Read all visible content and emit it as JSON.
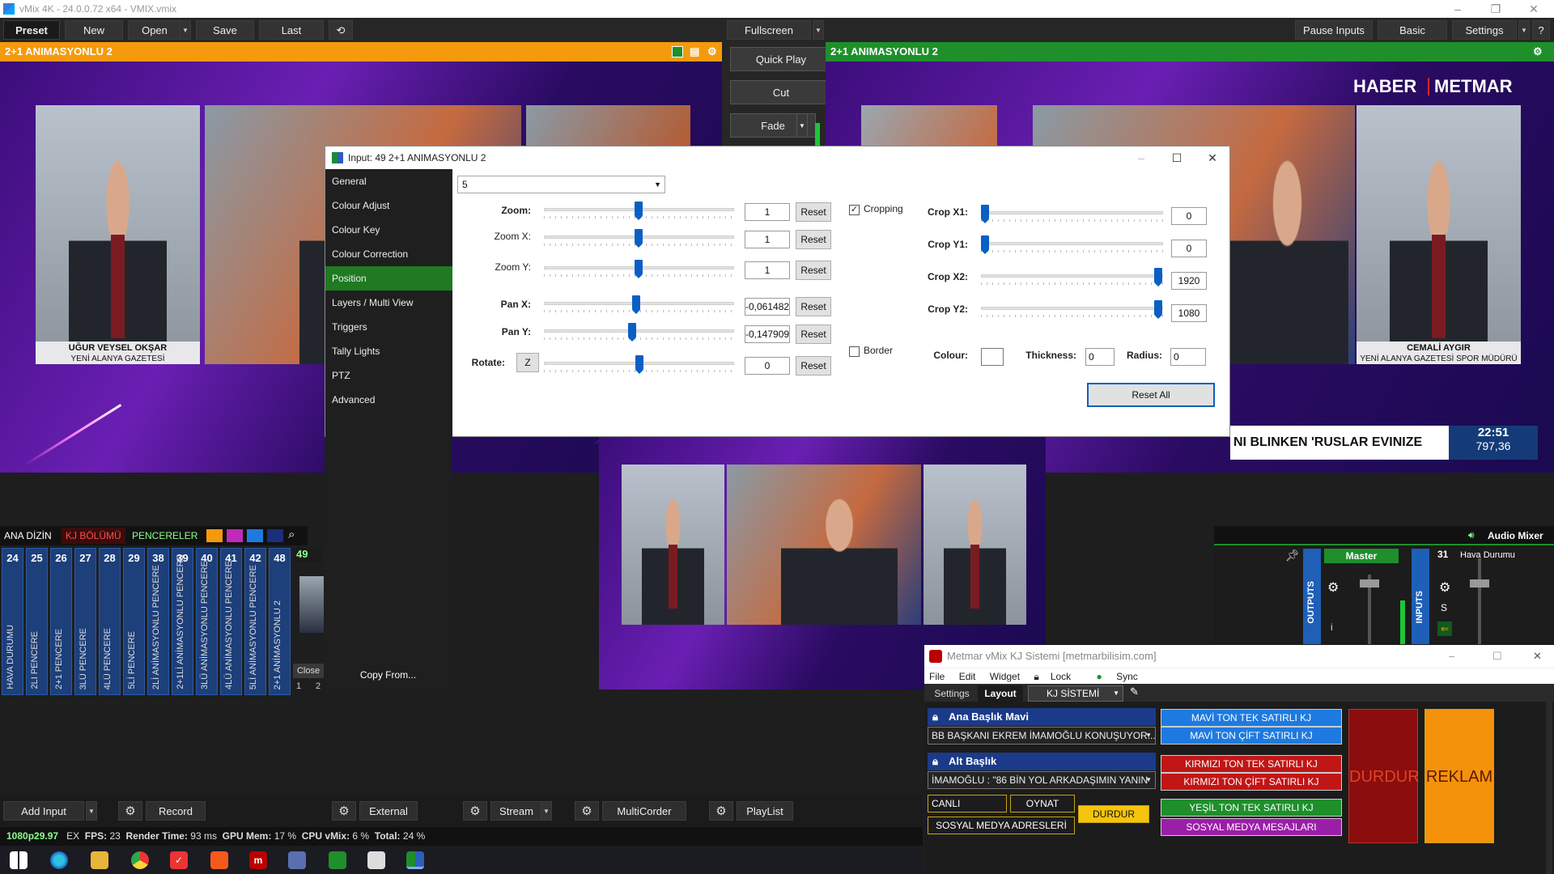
{
  "window": {
    "title": "vMix 4K - 24.0.0.72 x64 - VMIX.vmix"
  },
  "toolbar": {
    "preset": "Preset",
    "new": "New",
    "open": "Open",
    "save": "Save",
    "last": "Last",
    "fullscreen": "Fullscreen",
    "pause_inputs": "Pause Inputs",
    "basic": "Basic",
    "settings": "Settings",
    "help": "?"
  },
  "preview": {
    "title": "2+1 ANIMASYONLU 2"
  },
  "output": {
    "title": "2+1 ANIMASYONLU 2",
    "brand_left": "HABER",
    "brand_right": "METMAR",
    "ticker": "NI BLINKEN 'RUSLAR EVINIZE",
    "time": "22:51",
    "price": "797,36"
  },
  "cards": {
    "left_name": "UĞUR VEYSEL OKŞAR",
    "left_sub": "YENİ ALANYA GAZETESİ",
    "right_name": "CEMALİ AYGIR",
    "right_sub": "YENİ ALANYA GAZETESİ SPOR MÜDÜRÜ"
  },
  "transitions": {
    "quick_play": "Quick Play",
    "cut": "Cut",
    "fade": "Fade"
  },
  "dialog": {
    "title": "Input: 49 2+1 ANIMASYONLU 2",
    "sidebar": [
      "General",
      "Colour Adjust",
      "Colour Key",
      "Colour Correction",
      "Position",
      "Layers / Multi View",
      "Triggers",
      "Tally Lights",
      "PTZ",
      "Advanced"
    ],
    "active_tab": "Position",
    "copy_from": "Copy From...",
    "preset_select": "5",
    "zoom_label": "Zoom:",
    "zoom_value": "1",
    "zoomx_label": "Zoom X:",
    "zoomx_value": "1",
    "zoomy_label": "Zoom Y:",
    "zoomy_value": "1",
    "panx_label": "Pan X:",
    "panx_value": "-0,0614827",
    "pany_label": "Pan Y:",
    "pany_value": "-0,1479095",
    "rotate_label": "Rotate:",
    "rotate_z": "Z",
    "rotate_value": "0",
    "reset": "Reset",
    "cropping_label": "Cropping",
    "cropping_checked": true,
    "cropx1_label": "Crop X1:",
    "cropx1_value": "0",
    "cropy1_label": "Crop Y1:",
    "cropy1_value": "0",
    "cropx2_label": "Crop X2:",
    "cropx2_value": "1920",
    "cropy2_label": "Crop Y2:",
    "cropy2_value": "1080",
    "border_label": "Border",
    "border_checked": false,
    "colour_label": "Colour:",
    "thickness_label": "Thickness:",
    "thickness_value": "0",
    "radius_label": "Radius:",
    "radius_value": "0",
    "reset_all": "Reset All"
  },
  "input_tabs": {
    "ana": "ANA DİZİN",
    "kj": "KJ BÖLÜMÜ",
    "pencereler": "PENCERELER"
  },
  "inputs": [
    {
      "n": "24",
      "label": "HAVA DURUMU"
    },
    {
      "n": "25",
      "label": "2LI PENCERE"
    },
    {
      "n": "26",
      "label": "2+1 PENCERE"
    },
    {
      "n": "27",
      "label": "3LÜ PENCERE"
    },
    {
      "n": "28",
      "label": "4LÜ PENCERE"
    },
    {
      "n": "29",
      "label": "5Lİ PENCERE"
    },
    {
      "n": "38",
      "label": "2Lİ ANİMASYONLU PENCERE"
    },
    {
      "n": "39",
      "label": "2+1Lİ ANİMASYONLU PENCERE"
    },
    {
      "n": "40",
      "label": "3LÜ ANİMASYONLU PENCERE"
    },
    {
      "n": "41",
      "label": "4LÜ ANİMASYONLU PENCERE"
    },
    {
      "n": "42",
      "label": "5Lİ ANİMASYONLU PENCERE"
    },
    {
      "n": "48",
      "label": "2+1 ANİMASYONLU 2"
    }
  ],
  "input49": {
    "n": "49",
    "close": "Close",
    "page1": "1",
    "page2": "2"
  },
  "audio": {
    "title": "Audio Mixer",
    "master": "Master",
    "outputs": "OUTPUTS",
    "inputs": "INPUTS",
    "ch31": "31",
    "ch31_name": "Hava Durumu I",
    "s": "S",
    "i": "i"
  },
  "bottom": {
    "add_input": "Add Input",
    "record": "Record",
    "external": "External",
    "stream": "Stream",
    "multicorder": "MultiCorder",
    "playlist": "PlayList"
  },
  "status": {
    "format": "1080p29.97",
    "ex": "EX",
    "fps_label": "FPS:",
    "fps": "23",
    "render_label": "Render Time:",
    "render": "93 ms",
    "gpu_label": "GPU Mem:",
    "gpu": "17 %",
    "cpu_label": "CPU vMix:",
    "cpu": "6 %",
    "total_label": "Total:",
    "total": "24 %"
  },
  "kj": {
    "title": "Metmar vMix KJ Sistemi [metmarbilisim.com]",
    "menu": [
      "File",
      "Edit",
      "Widget",
      "Lock",
      "Sync"
    ],
    "tab_settings": "Settings",
    "tab_layout": "Layout",
    "layout_select": "KJ SİSTEMİ",
    "group1": "Ana Başlık Mavi",
    "group1_value": "BB BAŞKANI EKREM İMAMOĞLU KONUŞUYOR...",
    "group2": "Alt Başlık",
    "group2_value": "İMAMOĞLU : \"86 BİN YOL ARKADAŞIMIN YANIN",
    "canli": "CANLI",
    "oynat": "OYNAT",
    "durdur_small": "DURDUR",
    "sosyal": "SOSYAL MEDYA ADRESLERİ",
    "btn_mavi_tek": "MAVİ TON TEK SATIRLI KJ",
    "btn_mavi_cift": "MAVİ TON ÇİFT SATIRLI KJ",
    "btn_kirmizi_tek": "KIRMIZI TON TEK SATIRLI KJ",
    "btn_kirmizi_cift": "KIRMIZI TON ÇİFT SATIRLI KJ",
    "btn_yesil_tek": "YEŞİL TON TEK SATIRLI KJ",
    "btn_sosyal_mesaj": "SOSYAL MEDYA MESAJLARI",
    "durdur_big": "DURDUR",
    "reklam": "REKLAM"
  },
  "colors": {
    "preview_bar": "#f59a0c",
    "output_bar": "#1e8f2b",
    "active_tab": "#1f7a22",
    "accent_blue": "#0a5fc4"
  }
}
